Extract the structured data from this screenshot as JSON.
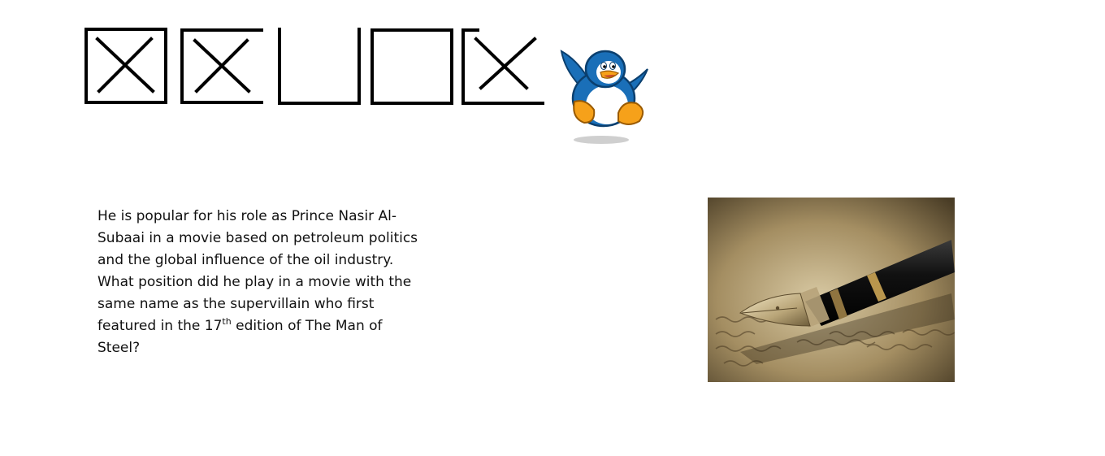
{
  "quiz": {
    "answer_boxes": [
      {
        "state": "crossed"
      },
      {
        "state": "crossed"
      },
      {
        "state": "empty"
      },
      {
        "state": "empty"
      },
      {
        "state": "crossed"
      }
    ],
    "question_parts": {
      "before_ordinal": "He is popular for his role as Prince Nasir Al-Subaai in a movie based on petroleum politics and the global influence of the oil industry. What position did he play in a movie with the same name as the supervillain who first featured in the 17",
      "ordinal_suffix": "th",
      "after_ordinal": " edition of The Man of Steel?"
    }
  },
  "decorations": {
    "mascot_icon": "penguin-icon",
    "photo_icon": "fountain-pen-icon"
  },
  "colors": {
    "penguin_blue": "#1a6fb8",
    "penguin_orange": "#f6a11a",
    "photo_tone": "#8a7550"
  }
}
